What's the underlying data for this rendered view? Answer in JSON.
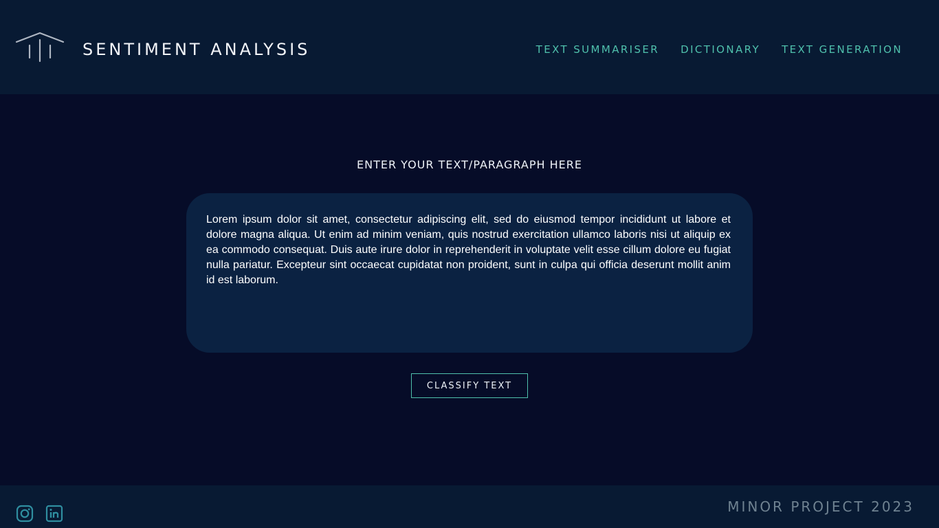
{
  "header": {
    "logo_icon": "building-columns-icon",
    "title": "SENTIMENT ANALYSIS",
    "nav": [
      {
        "label": "TEXT SUMMARISER"
      },
      {
        "label": "DICTIONARY"
      },
      {
        "label": "TEXT GENERATION"
      }
    ]
  },
  "main": {
    "prompt_label": "ENTER YOUR TEXT/PARAGRAPH HERE",
    "text_input_value": "Lorem ipsum dolor sit amet, consectetur adipiscing elit, sed do eiusmod tempor incididunt ut labore et dolore magna aliqua. Ut enim ad minim veniam, quis nostrud exercitation ullamco laboris nisi ut aliquip ex ea commodo consequat. Duis aute irure dolor in reprehenderit in voluptate velit esse cillum dolore eu fugiat nulla pariatur. Excepteur sint occaecat cupidatat non proident, sunt in culpa qui officia deserunt mollit anim id est laborum.",
    "classify_button_label": "CLASSIFY TEXT"
  },
  "footer": {
    "social_icons": [
      "instagram-icon",
      "linkedin-icon"
    ],
    "text": "MINOR PROJECT 2023"
  },
  "colors": {
    "page_background": "#060c28",
    "header_background": "#081a33",
    "textbox_background": "#0b2242",
    "accent": "#4fc0ac",
    "footer_text": "#6f8291"
  }
}
